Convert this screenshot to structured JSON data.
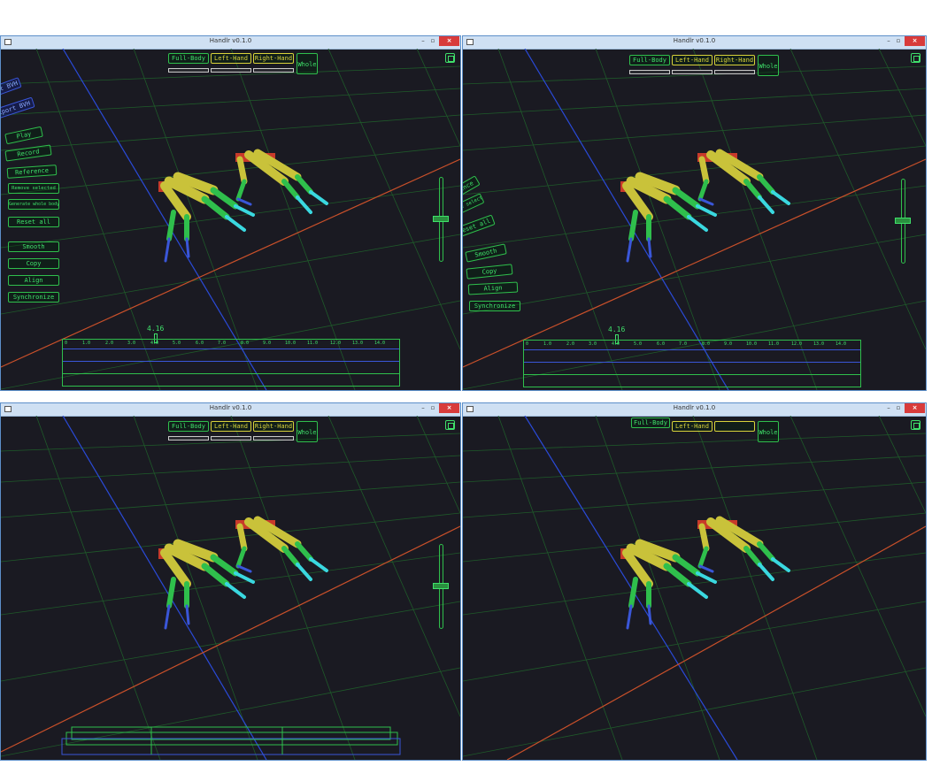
{
  "app_title": "Handlr v0.1.0",
  "window_controls": {
    "minimize": "–",
    "maximize": "▫",
    "close": "×"
  },
  "mode_buttons": {
    "full_body": "Full-Body",
    "left_hand": "Left-Hand",
    "right_hand": "Right-Hand",
    "whole": "Whole"
  },
  "side_menu": {
    "import_bvh": "Import BVH",
    "export_bvh": "Export BVH",
    "play": "Play",
    "record": "Record",
    "reference": "Reference",
    "remove_selected": "Remove selected",
    "generate_whole_body": "Generate whole body",
    "reset_all": "Reset all",
    "smooth": "Smooth",
    "copy": "Copy",
    "align": "Align",
    "synchronize": "Synchronize"
  },
  "timeline": {
    "cursor_value": "4.16",
    "ticks": [
      "0",
      "1.0",
      "2.0",
      "3.0",
      "4.0",
      "5.0",
      "6.0",
      "7.0",
      "8.0",
      "9.0",
      "10.0",
      "11.0",
      "12.0",
      "13.0",
      "14.0"
    ]
  },
  "colors": {
    "accent": "#3fe06a",
    "selected": "#d8d23a",
    "scene_bg": "#1a1a22",
    "blue_axis": "#2a4ad8",
    "red_axis": "#c9502a"
  }
}
